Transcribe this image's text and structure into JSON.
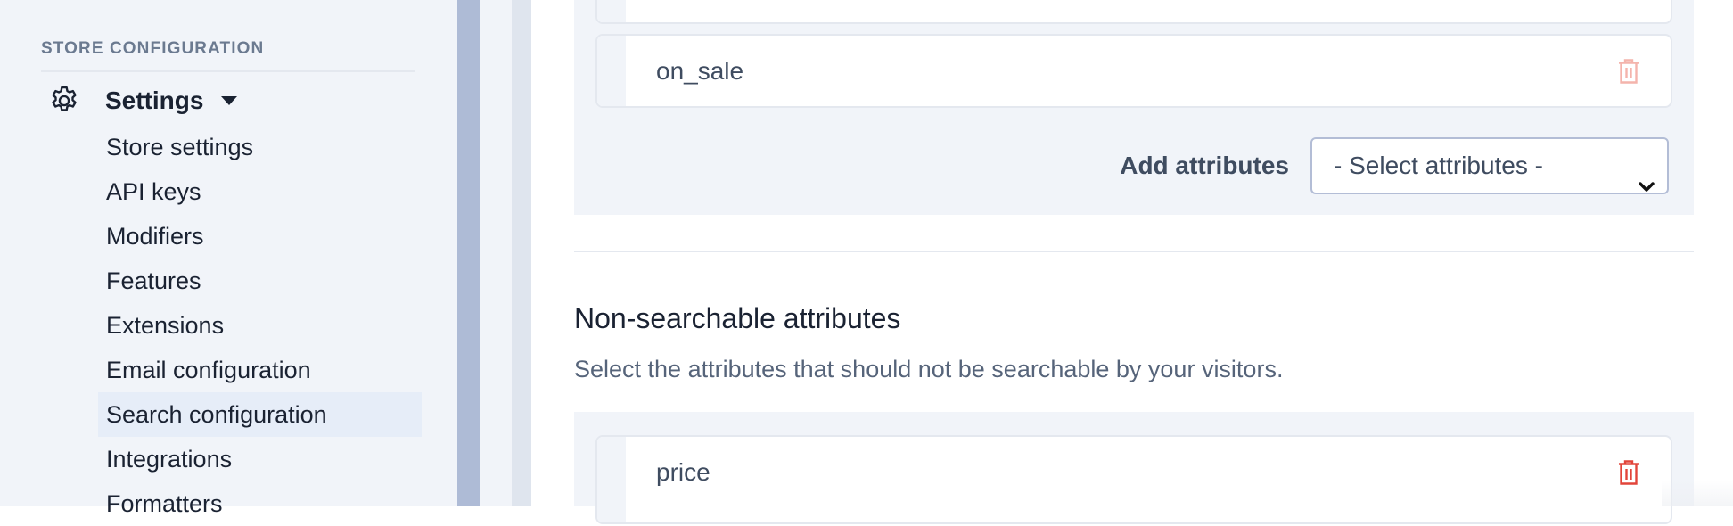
{
  "sidebar": {
    "section_label": "STORE CONFIGURATION",
    "settings": {
      "label": "Settings",
      "icon": "gear-icon",
      "expanded": true
    },
    "items": [
      {
        "label": "Store settings",
        "active": false
      },
      {
        "label": "API keys",
        "active": false
      },
      {
        "label": "Modifiers",
        "active": false
      },
      {
        "label": "Features",
        "active": false
      },
      {
        "label": "Extensions",
        "active": false
      },
      {
        "label": "Email configuration",
        "active": false
      },
      {
        "label": "Search configuration",
        "active": true
      },
      {
        "label": "Integrations",
        "active": false
      },
      {
        "label": "Formatters",
        "active": false
      }
    ]
  },
  "searchable": {
    "attributes": [
      {
        "name": ""
      },
      {
        "name": "on_sale",
        "delete_enabled": false
      }
    ],
    "add_label": "Add attributes",
    "select_placeholder": "- Select attributes -"
  },
  "non_searchable": {
    "title": "Non-searchable attributes",
    "description": "Select the attributes that should not be searchable by your visitors.",
    "attributes": [
      {
        "name": "price",
        "delete_enabled": true
      }
    ]
  },
  "colors": {
    "trash_disabled": "#f4b4ac",
    "trash_active": "#e2453a",
    "active_nav_bg": "#e6edf8"
  }
}
